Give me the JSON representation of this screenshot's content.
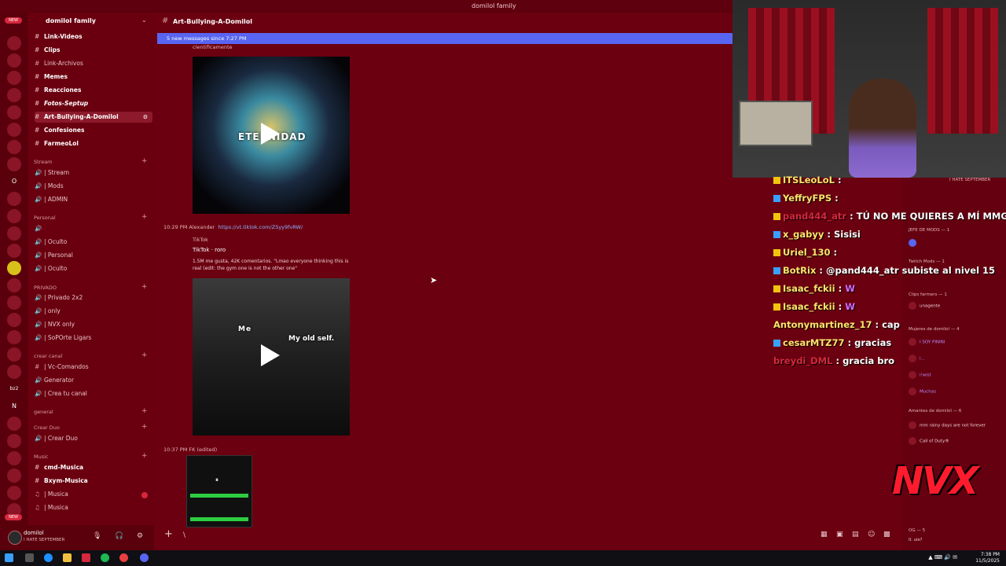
{
  "window": {
    "title": "domilol family"
  },
  "colors": {
    "background": "#6b0010",
    "accent": "#5865f2",
    "link": "#8ab4ff",
    "badge": "#d6283d",
    "nvx": "#ff1b2d"
  },
  "rail": {
    "new_top": "NEW",
    "new_bottom": "NEW",
    "letters": [
      "O",
      "N"
    ],
    "bz2": "bz2"
  },
  "sidebar": {
    "guild_name": "domilol family",
    "channels_top": [
      {
        "label": "Link-Videos"
      },
      {
        "label": "Clips"
      },
      {
        "label": "Link-Archivos"
      },
      {
        "label": "Memes"
      },
      {
        "label": "Reacciones"
      },
      {
        "label": "Fotos-Septup"
      },
      {
        "label": "Art-Bullying-A-Domilol"
      },
      {
        "label": "Confesiones"
      },
      {
        "label": "FarmeoLol"
      }
    ],
    "categories": {
      "stream": "Stream",
      "personal": "Personal",
      "privado": "PRIVADO",
      "crear_canal": "crear canal",
      "general": "general",
      "crear_duo": "Crear Duo",
      "music": "Music"
    },
    "stream_channels": [
      "| Stream",
      "| Mods",
      "| ADMIN"
    ],
    "personal_channels": [
      "| Oculto",
      "| Personal",
      "| Oculto"
    ],
    "privado_channels": [
      "| Privado 2x2",
      "| only",
      "| NVX only",
      "| SoPOrte Ligars"
    ],
    "crear_canal_channels": [
      "| Vc-Comandos",
      "Generator",
      "| Crea tu canal"
    ],
    "crear_duo_channels": [
      "| Crear Duo"
    ],
    "music_channels": [
      "cmd-Musica",
      "Bxym-Musica",
      "| Musica",
      "| Musica"
    ]
  },
  "user": {
    "name": "domilol",
    "status": "I HATE SEPTEMBER"
  },
  "channel": {
    "title": "Art-Bullying-A-Domilol",
    "new_messages": "5 new messages since 7:27 PM",
    "partial_text": "cientificamente",
    "video1_overlay": "ETERNIDAD",
    "msg2_time": "10:29 PM",
    "msg2_author": "Alexander",
    "msg2_link": "https://vt.tiktok.com/ZSyy9fvRW/",
    "embed_provider": "TikTok",
    "embed_title": "TikTok · roro",
    "embed_desc": "1.5M me gusta, 42K comentarios. \"Lmao everyone thinking this is real (edit: the gym one is not the other one\"",
    "video2_label_left": "Me",
    "video2_label_right": "My old self.",
    "msg3_time": "10:37 PM",
    "msg3_author": "FK",
    "msg3_edited": "(edited)"
  },
  "stream_chat": [
    {
      "user": "ITSLeoLoL",
      "msg": "",
      "color": "#ffe46b"
    },
    {
      "user": "YeffryFPS",
      "msg": "",
      "color": "#ffe46b"
    },
    {
      "user": "pand444_atr",
      "msg": "TÚ NO ME QUIERES A MÍ MMG",
      "color": "#d6283d"
    },
    {
      "user": "x_gabyy",
      "msg": "Sisisi",
      "color": "#ffe46b"
    },
    {
      "user": "Uriel_130",
      "msg": "",
      "color": "#ffe46b"
    },
    {
      "user": "BotRix",
      "msg": "@pand444_atr subiste al nivel 15",
      "color": "#ffe46b"
    },
    {
      "user": "Isaac_fckii",
      "msg": "W",
      "color": "#ffe46b"
    },
    {
      "user": "Isaac_fckii",
      "msg": "W",
      "color": "#ffe46b"
    },
    {
      "user": "Antonymartinez_17",
      "msg": "cap",
      "color": "#ffe46b"
    },
    {
      "user": "cesarMTZ77",
      "msg": "gracias",
      "color": "#ffe46b"
    },
    {
      "user": "breydi_DML",
      "msg": "gracia bro",
      "color": "#d6283d"
    }
  ],
  "members": {
    "top_status": "I HATE SEPTEMBER",
    "jefe": "JEFE DE MODS — 1",
    "twitch_mods": "Twitch Mods — 1",
    "clips_farmers": "Clips farmers — 1",
    "clips_member": "unagente",
    "mujeres": "Mujeres de domilol — 4",
    "mujeres_members": [
      "I SOY PININI",
      "i...",
      "i!wist",
      "Muchas"
    ],
    "amantes": "Amantes de domilol — 6",
    "amantes_status": "mm rainy days are not forever",
    "call_of_duty": "Call of Duty®",
    "og": "OG — 5",
    "og_member": "Il. uis?"
  },
  "overlay_logo": "NVX",
  "taskbar": {
    "time": "7:38 PM",
    "date": "11/5/2025"
  }
}
